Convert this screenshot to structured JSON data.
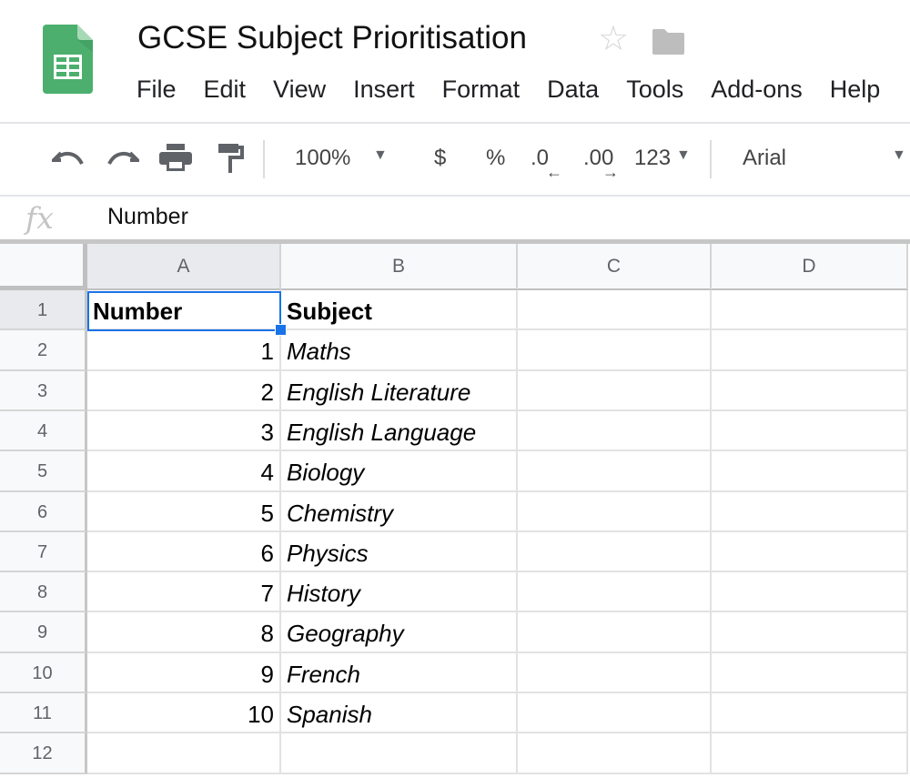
{
  "app": {
    "title": "GCSE Subject Prioritisation",
    "icons": {
      "logo": "google-sheets-logo",
      "star": "star-icon",
      "folder": "folder-icon"
    }
  },
  "menu": [
    "File",
    "Edit",
    "View",
    "Insert",
    "Format",
    "Data",
    "Tools",
    "Add-ons",
    "Help"
  ],
  "toolbar": {
    "zoom": "100%",
    "currency": "$",
    "percent": "%",
    "decrease_decimal": ".0",
    "increase_decimal": ".00",
    "more_formats": "123",
    "font": "Arial"
  },
  "formula_bar": {
    "fx_label": "fx",
    "value": "Number"
  },
  "sheet": {
    "columns": [
      "A",
      "B",
      "C",
      "D"
    ],
    "rows": [
      "1",
      "2",
      "3",
      "4",
      "5",
      "6",
      "7",
      "8",
      "9",
      "10",
      "11",
      "12"
    ],
    "selected_cell": "A1",
    "selection_color": "#1a73e8",
    "cells": [
      [
        "Number",
        "Subject"
      ],
      [
        "1",
        "Maths"
      ],
      [
        "2",
        "English Literature"
      ],
      [
        "3",
        "English Language"
      ],
      [
        "4",
        "Biology"
      ],
      [
        "5",
        "Chemistry"
      ],
      [
        "6",
        "Physics"
      ],
      [
        "7",
        "History"
      ],
      [
        "8",
        "Geography"
      ],
      [
        "9",
        "French"
      ],
      [
        "10",
        "Spanish"
      ],
      [
        "",
        ""
      ]
    ]
  }
}
